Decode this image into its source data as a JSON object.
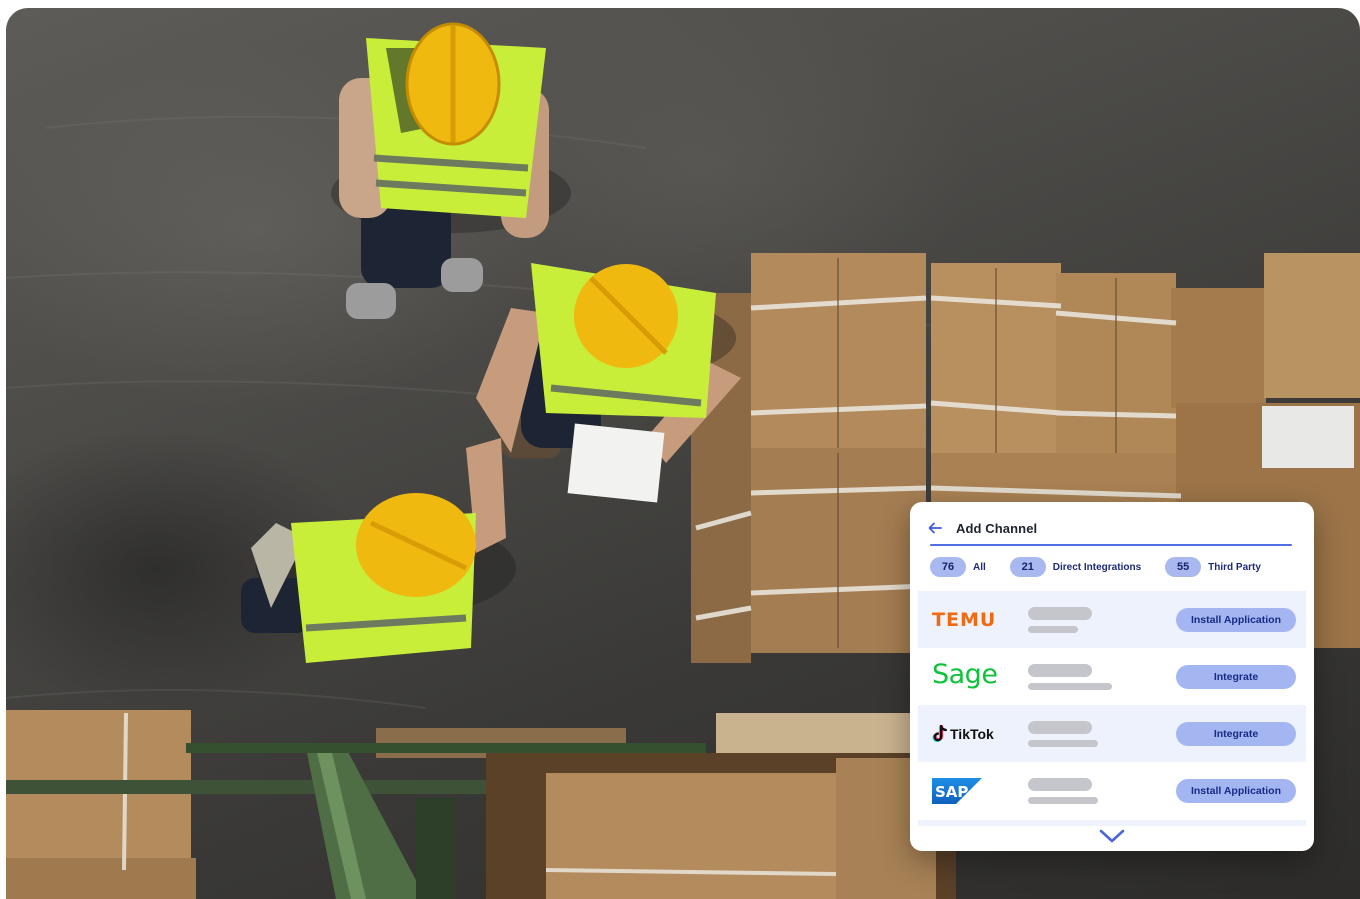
{
  "panel": {
    "title": "Add Channel"
  },
  "filters": [
    {
      "count": "76",
      "label": "All"
    },
    {
      "count": "21",
      "label": "Direct Integrations"
    },
    {
      "count": "55",
      "label": "Third Party"
    }
  ],
  "channels": [
    {
      "logo_text": "TEMU",
      "button": "Install Application"
    },
    {
      "logo_text": "Sage",
      "button": "Integrate"
    },
    {
      "logo_text": "TikTok",
      "button": "Integrate"
    },
    {
      "logo_text": "SAP",
      "button": "Install Application"
    }
  ],
  "colors": {
    "accent": "#4f6fe0",
    "pill": "#a9b9ef",
    "button": "#a4b6f1",
    "row_alt": "#eef2fc",
    "temu": "#f06a13",
    "sage": "#10c23a",
    "sap": "#1b75d1"
  },
  "icons": {
    "back": "arrow-left-icon",
    "more": "chevron-down-icon",
    "tiktok": "tiktok-note-icon"
  }
}
